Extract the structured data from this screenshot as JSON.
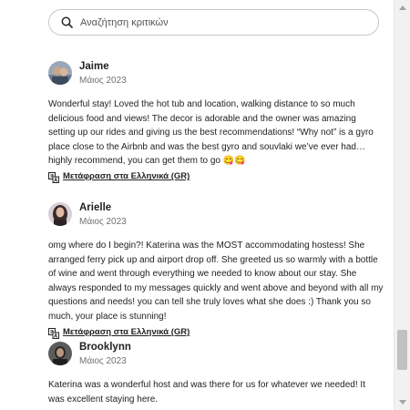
{
  "search": {
    "placeholder": "Αναζήτηση κριτικών"
  },
  "reviews": [
    {
      "name": "Jaime",
      "date": "Μάιος 2023",
      "text": "Wonderful stay! Loved the hot tub and location, walking distance to so much delicious food and views! The decor is adorable and the owner was amazing setting up our rides and giving us the best recommendations! “Why not” is a gyro place close to the Airbnb and was the best gyro and souvlaki we’ve ever had… highly recommend, you can get them to go 😋😋",
      "translate": "Μετάφραση στα Ελληνικά (GR)"
    },
    {
      "name": "Arielle",
      "date": "Μάιος 2023",
      "text": "omg where do I begin?! Katerina was the MOST accommodating hostess! She arranged ferry pick up and airport drop off. She greeted us so warmly with a bottle of wine and went through everything we needed to know about our stay. She always responded to my messages quickly and went above and beyond with all my questions and needs! you can tell she truly loves what she does :) Thank you so much, your place is stunning!",
      "translate": "Μετάφραση στα Ελληνικά (GR)"
    },
    {
      "name": "Brooklynn",
      "date": "Μάιος 2023",
      "text": "Katerina was a wonderful host and was there for us for whatever we needed! It was excellent staying here."
    }
  ],
  "colors": {
    "text": "#222222",
    "muted": "#717171",
    "border": "#c8c8c8"
  },
  "icons": [
    "search-icon",
    "translate-icon",
    "scroll-up-arrow",
    "scroll-down-arrow"
  ]
}
